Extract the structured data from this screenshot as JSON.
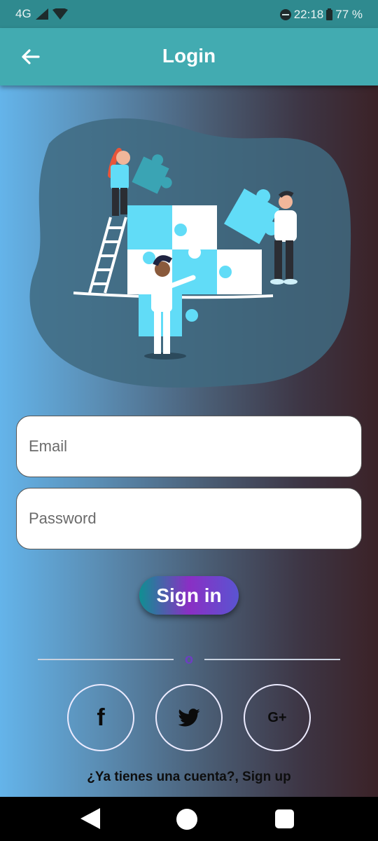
{
  "status_bar": {
    "network": "4G",
    "time": "22:18",
    "battery": "77 %"
  },
  "app_bar": {
    "title": "Login",
    "back_icon": "arrow-left-icon"
  },
  "illustration": {
    "icon": "team-puzzle-illustration"
  },
  "form": {
    "email_placeholder": "Email",
    "password_placeholder": "Password",
    "signin_label": "Sign in"
  },
  "divider": {
    "text": "o"
  },
  "social": {
    "facebook_glyph": "f",
    "google_glyph": "G+",
    "twitter_icon": "twitter-bird-icon"
  },
  "footer": {
    "signup_text": "¿Ya tienes una cuenta?, Sign up"
  },
  "colors": {
    "app_bar": "#42abb1",
    "status_bar": "#2f8a8f",
    "gradient_left": "#64b4ea",
    "gradient_right": "#3b2227",
    "puzzle_cyan": "#61dcf7"
  }
}
